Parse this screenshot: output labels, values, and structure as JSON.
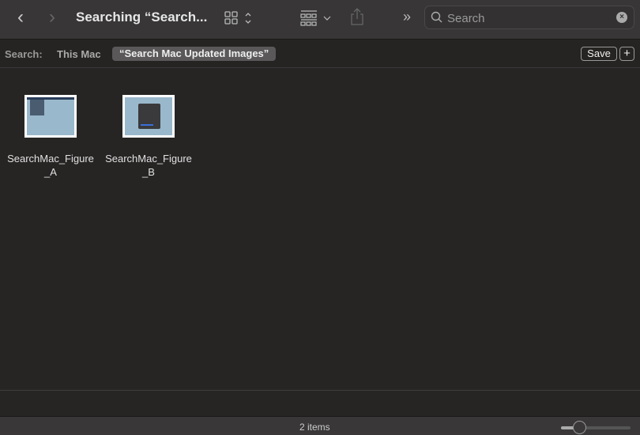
{
  "toolbar": {
    "title": "Searching “Search...",
    "search_placeholder": "Search"
  },
  "search_bar": {
    "label": "Search:",
    "scope_this_mac": "This Mac",
    "scope_selected": "“Search Mac Updated Images”",
    "save": "Save",
    "add": "+"
  },
  "files": [
    {
      "name": "SearchMac_Figure_A"
    },
    {
      "name": "SearchMac_Figure_B"
    }
  ],
  "status": {
    "count": "2 items",
    "icon_size_percent": 26
  }
}
